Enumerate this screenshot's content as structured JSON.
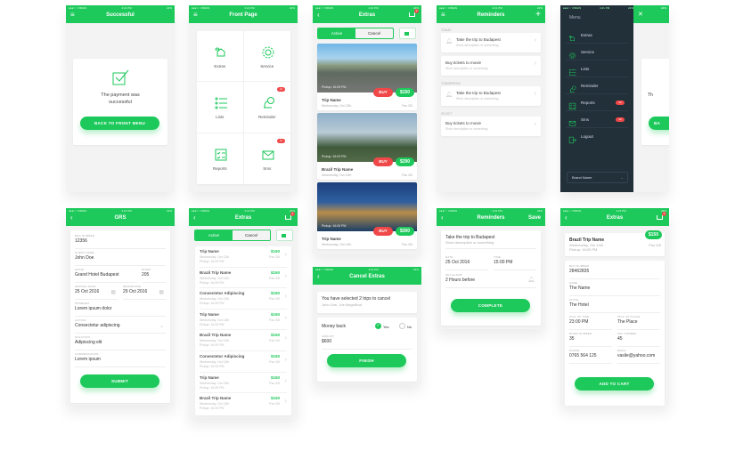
{
  "status": {
    "carrier": "●●●○○ VIRGIN",
    "time": "4:21 PM",
    "battery": "22%"
  },
  "colors": {
    "accent": "#1dc95b",
    "danger": "#f04848",
    "drawer": "#22303a"
  },
  "successful": {
    "title": "Successful",
    "message_line1": "The payment was",
    "message_line2": "successful",
    "button": "BACK TO FRONT MENU"
  },
  "front_page": {
    "title": "Front Page",
    "tiles": [
      {
        "label": "Extras"
      },
      {
        "label": "Service"
      },
      {
        "label": "Lists"
      },
      {
        "label": "Reminder",
        "badge": "12"
      },
      {
        "label": "Reports"
      },
      {
        "label": "Sms",
        "badge": "12"
      }
    ]
  },
  "extras_cards": {
    "title": "Extras",
    "cart_count": "3",
    "tab_active": "Active",
    "tab_cancel": "Cancel",
    "buy_label": "BUY",
    "items": [
      {
        "pickup": "Pickup: 16:00 PM",
        "name": "Trip Name",
        "date": "Wednesday, Oct 12th",
        "pax": "Pax 3/5",
        "price": "$150"
      },
      {
        "pickup": "Pickup: 15:00 PM",
        "name": "Brazil Trip Name",
        "date": "Wednesday, Oct 12th",
        "pax": "Pax 3/5",
        "price": "$290"
      },
      {
        "pickup": "Pickup: 16:00 PM",
        "name": "Trip Name",
        "date": "Wednesday, Oct 12th",
        "pax": "Pax 3/5",
        "price": "$300"
      }
    ]
  },
  "reminders": {
    "title": "Reminders",
    "sections": [
      {
        "heading": "TODAY",
        "items": [
          {
            "title": "Take the trip to Budapest",
            "desc": "Short description or something",
            "bell": true
          },
          {
            "title": "Buy tickets to movie",
            "desc": "Short description or something",
            "bell": false
          }
        ]
      },
      {
        "heading": "TOMORROW",
        "items": [
          {
            "title": "Take the trip to Budapest",
            "desc": "Short description or something",
            "bell": true
          }
        ]
      },
      {
        "heading": "25 OCT",
        "items": [
          {
            "title": "Buy tickets to movie",
            "desc": "Short description or something",
            "bell": false
          }
        ]
      }
    ]
  },
  "menu": {
    "title": "Menu",
    "items": [
      {
        "label": "Extras"
      },
      {
        "label": "Service"
      },
      {
        "label": "Lists"
      },
      {
        "label": "Reminder"
      },
      {
        "label": "Reports",
        "badge": "12"
      },
      {
        "label": "Sms",
        "badge": "12"
      },
      {
        "label": "Logout"
      }
    ],
    "brand": "Brand Name",
    "peek_text": "Th",
    "peek_button": "BA"
  },
  "grs": {
    "title": "GRS",
    "fields": {
      "bag_label": "BAG NUMBER",
      "bag": "12356",
      "guest_label": "GUEST NAME",
      "guest": "John Doe",
      "hotel_label": "HOTEL",
      "hotel": "Grand Hotel Budapest",
      "room_label": "ROOM",
      "room": "205",
      "arrival_label": "ARRIVAL DATE",
      "arrival": "25 Oct 2016",
      "departure_label": "DEPARTURE",
      "departure": "29 Oct 2016",
      "problem_label": "PROBLEM",
      "problem": "Lorem ipsum dolor",
      "action_label": "ACTION",
      "action": "Consectetur adipiscing",
      "solution_label": "SOLUTION",
      "solution": "Adipiscing elit",
      "compensation_label": "COMPENSATION",
      "compensation": "Lorem ipsum"
    },
    "button": "SUBMIT"
  },
  "extras_list": {
    "title": "Extras",
    "cart_count": "3",
    "tab_active": "Active",
    "tab_cancel": "Cancel",
    "items": [
      {
        "name": "Trip Name",
        "date": "Wednesday, Oct 12th",
        "pickup": "Pickup: 16:00 PM",
        "price": "$150",
        "pax": "Pax 3/5"
      },
      {
        "name": "Brazil Trip Name",
        "date": "Wednesday, Oct 12th",
        "pickup": "Pickup: 16:00 PM",
        "price": "$150",
        "pax": "Pax 3/5"
      },
      {
        "name": "Consectetur Adipiscing",
        "date": "Wednesday, Oct 12th",
        "pickup": "Pickup: 16:00 PM",
        "price": "$150",
        "pax": "Pax 3/5"
      },
      {
        "name": "Trip Name",
        "date": "Wednesday, Oct 12th",
        "pickup": "Pickup: 16:00 PM",
        "price": "$150",
        "pax": "Pax 3/5"
      },
      {
        "name": "Brazil Trip Name",
        "date": "Wednesday, Oct 12th",
        "pickup": "Pickup: 16:00 PM",
        "price": "$150",
        "pax": "Pax 3/5"
      },
      {
        "name": "Consectetur Adipiscing",
        "date": "Wednesday, Oct 12th",
        "pickup": "Pickup: 16:00 PM",
        "price": "$150",
        "pax": "Pax 3/5"
      },
      {
        "name": "Trip Name",
        "date": "Wednesday, Oct 12th",
        "pickup": "Pickup: 16:00 PM",
        "price": "$150",
        "pax": "Pax 3/5"
      },
      {
        "name": "Brazil Trip Name",
        "date": "Wednesday, Oct 12th",
        "pickup": "Pickup: 16:00 PM",
        "price": "$150",
        "pax": "Pax 3/5"
      }
    ]
  },
  "cancel_extras": {
    "title": "Cancel Extras",
    "message": "You have selected 2 trips to cancel",
    "names": "John Doe, Joe Magnificut",
    "money_back": "Money back",
    "yes": "Yes",
    "no": "No",
    "amount_label": "AMOUNT",
    "amount": "$600",
    "button": "FINISH"
  },
  "reminder_edit": {
    "title": "Reminders",
    "save": "Save",
    "item_title": "Take the trip to Budapest",
    "item_desc": "Short description or something",
    "date_label": "DATE",
    "date": "25 Oct 2016",
    "time_label": "TIME",
    "time": "15:00 PM",
    "alarm_label": "SET ALARM",
    "alarm": "2 Hours before",
    "button": "COMPLETE"
  },
  "extras_detail": {
    "title": "Extras",
    "cart_count": "3",
    "trip": {
      "name": "Brazil Trip Name",
      "date": "Wednesday, Oct 12th",
      "pickup": "Pickup: 16:00 PM",
      "price": "$150",
      "pax": "Pax 3/5"
    },
    "fields": {
      "bkg_label": "BKG NUMBER",
      "bkg": "28462835",
      "name_label": "NAME",
      "name": "The Name",
      "hotel_label": "HOTEL",
      "hotel": "The Hotel",
      "pickup_time_label": "PICK UP TIME",
      "pickup_time": "23:00 PM",
      "pickup_place_label": "PICK UP PLACE",
      "pickup_place": "The Place",
      "room_label": "ROOM NUMBER",
      "room": "35",
      "pax_label": "PAX NUMBER",
      "pax": "45",
      "phone_label": "PHONE",
      "phone": "0765 564 125",
      "email_label": "EMAIL",
      "email": "vasile@yahoo.com"
    },
    "button": "ADD TO CART"
  }
}
